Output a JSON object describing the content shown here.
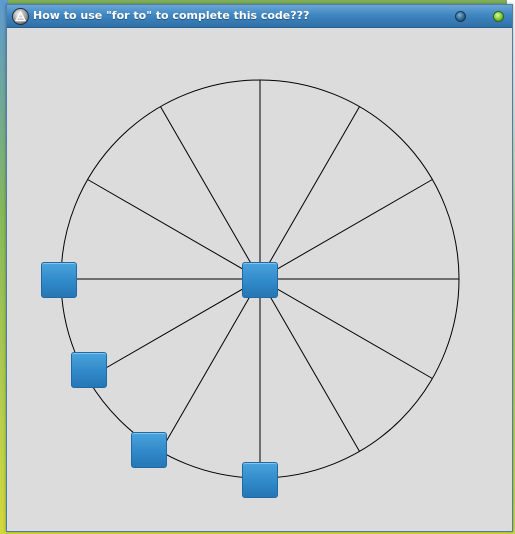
{
  "window": {
    "title": "How to use \"for to\" to complete this code???"
  },
  "icons": {
    "app": "app-icon",
    "minimize": "minimize-icon",
    "close": "close-icon"
  },
  "colors": {
    "titlebar": "#3f86c2",
    "canvas_bg": "#dcdcdc",
    "spoke_line": "#000000",
    "square_fill": "#2e87c6"
  },
  "wheel": {
    "spoke_count": 12
  },
  "squares": [
    {
      "id": "center"
    },
    {
      "id": "left"
    },
    {
      "id": "lower-left"
    },
    {
      "id": "bottom-left"
    },
    {
      "id": "bottom"
    }
  ]
}
